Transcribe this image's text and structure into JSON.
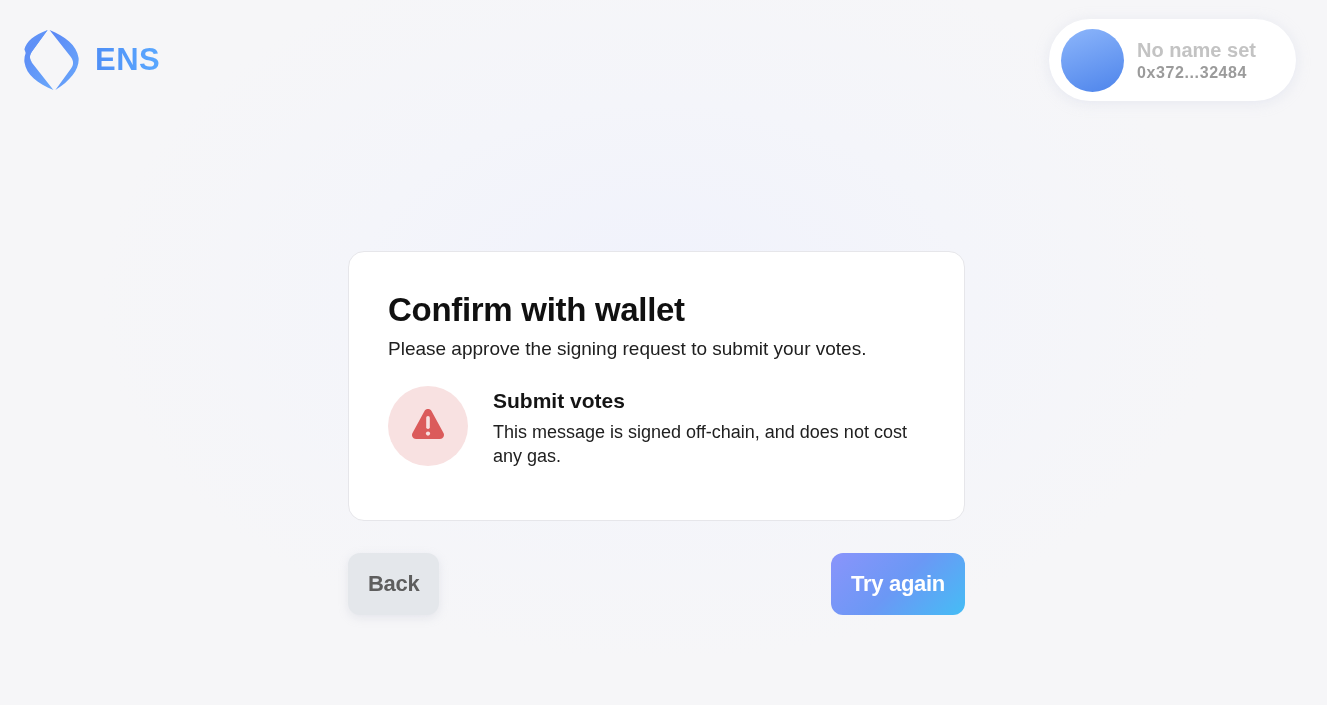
{
  "header": {
    "logo": {
      "text": "ENS"
    },
    "account": {
      "name": "No name set",
      "address": "0x372...32484"
    }
  },
  "dialog": {
    "title": "Confirm with wallet",
    "subtitle": "Please approve the signing request to submit your votes.",
    "notice": {
      "kind": "warning",
      "title": "Submit votes",
      "text": "This message is signed off-chain, and does not cost any gas."
    }
  },
  "buttons": [
    {
      "label": "Back",
      "kind": "secondary"
    },
    {
      "label": "Try again",
      "kind": "primary"
    }
  ]
}
